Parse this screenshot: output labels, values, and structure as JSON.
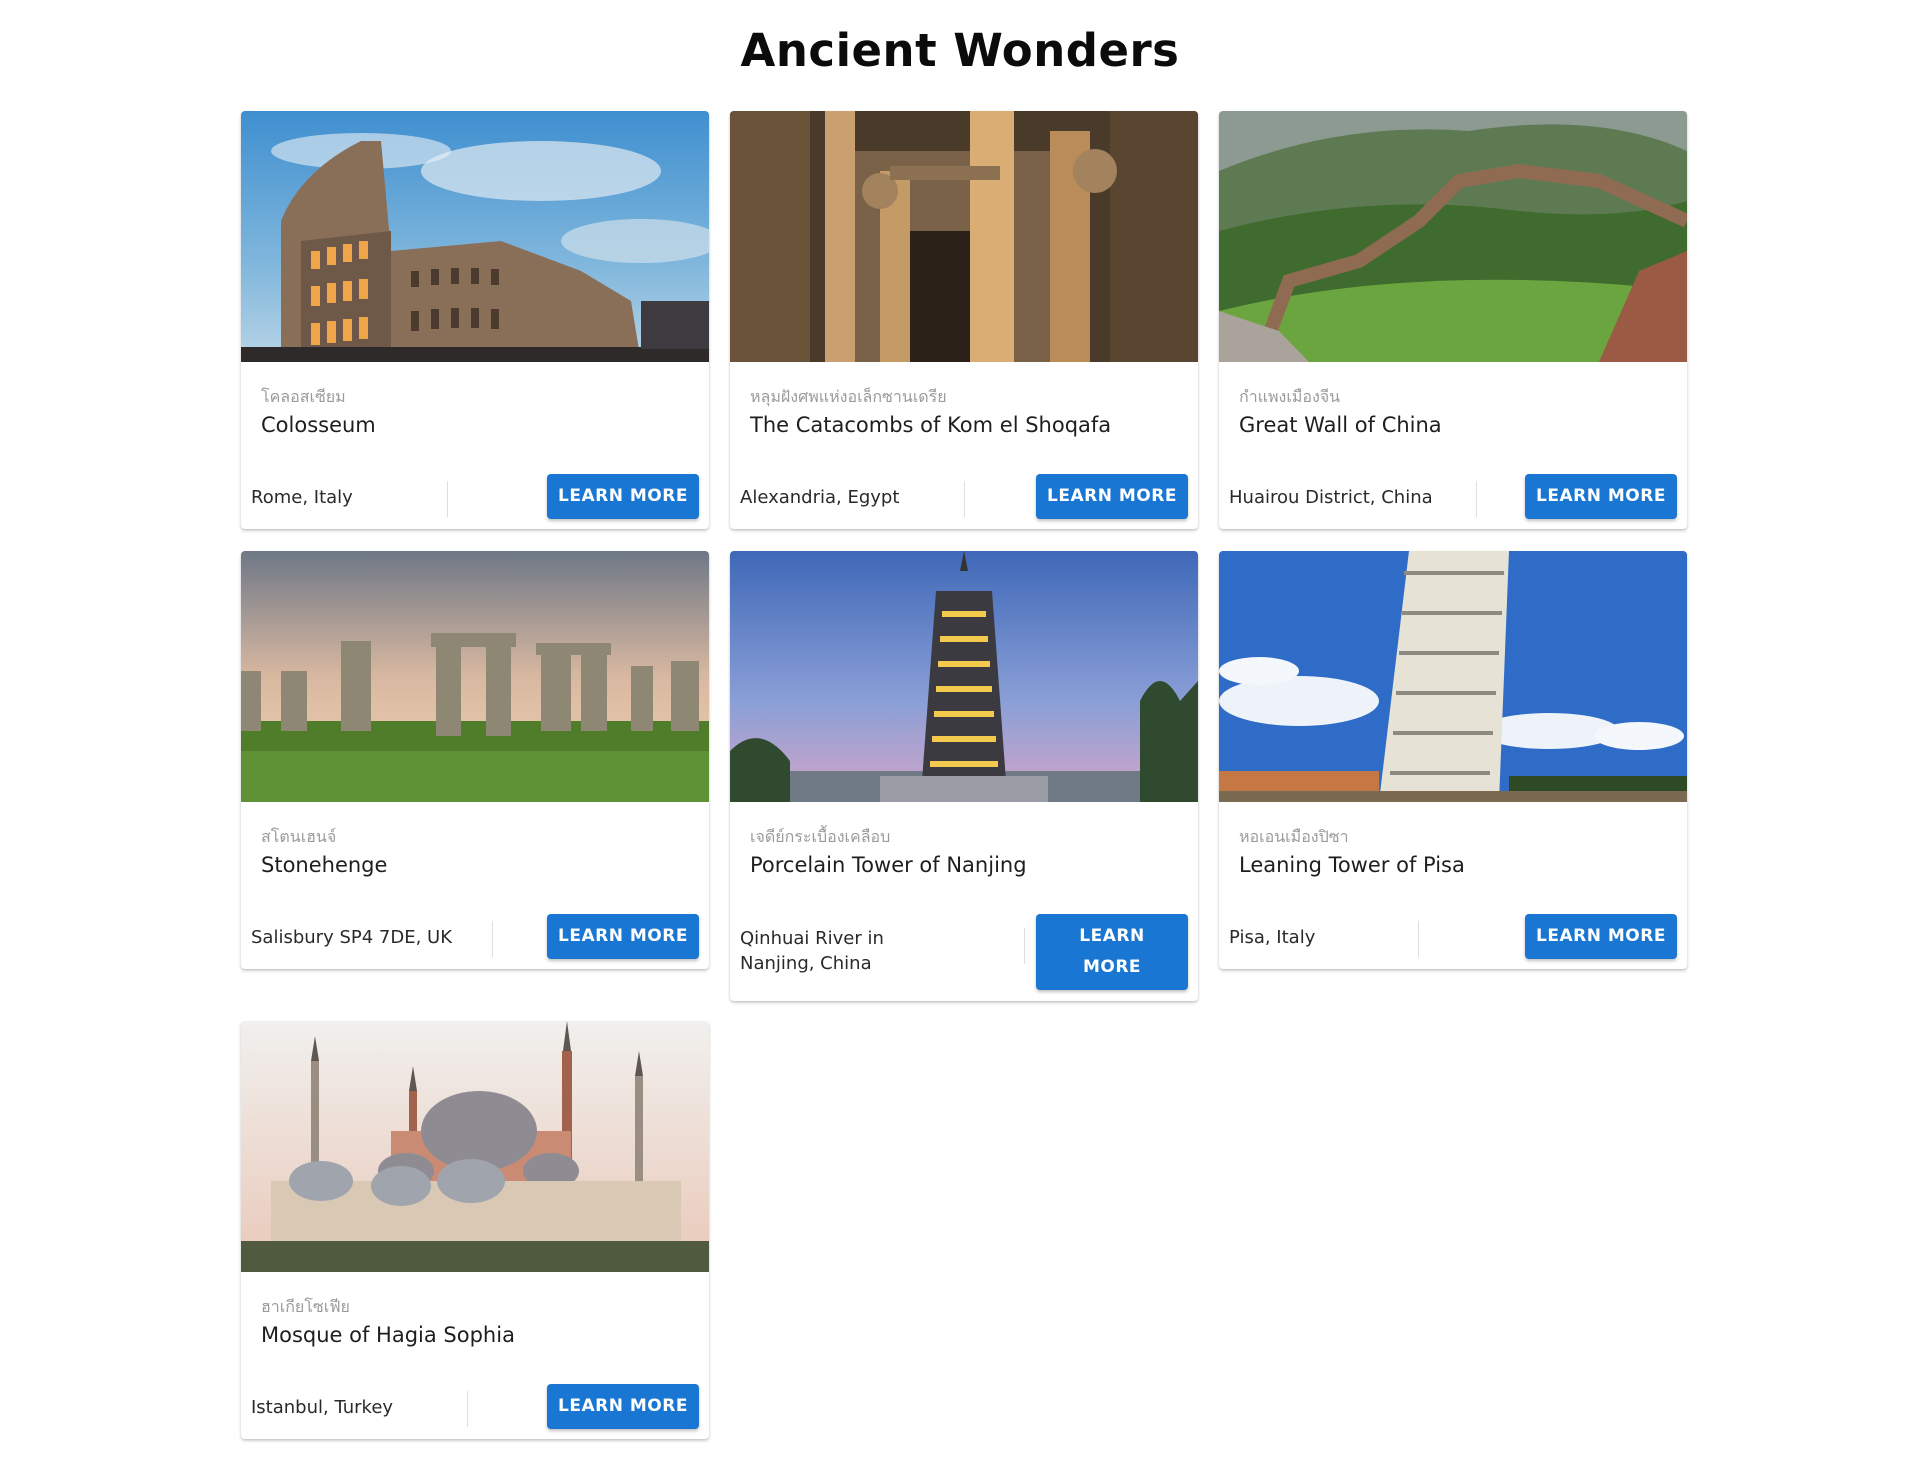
{
  "page": {
    "title": "Ancient Wonders"
  },
  "button_label": "Learn More",
  "colors": {
    "accent": "#1976d2",
    "subtitle": "#9b9b9b",
    "title": "#1e1e1e"
  },
  "cards": [
    {
      "subtitle": "โคลอสเซียม",
      "title": "Colosseum",
      "location": "Rome, Italy",
      "image": "colosseum-photo"
    },
    {
      "subtitle": "หลุมฝังศพแห่งอเล็กซานเดรีย",
      "title": "The Catacombs of Kom el Shoqafa",
      "location": "Alexandria, Egypt",
      "image": "catacombs-photo"
    },
    {
      "subtitle": "กำแพงเมืองจีน",
      "title": "Great Wall of China",
      "location": "Huairou District, China",
      "image": "great-wall-photo"
    },
    {
      "subtitle": "สโตนเฮนจ์",
      "title": "Stonehenge",
      "location": "Salisbury SP4 7DE, UK",
      "image": "stonehenge-photo"
    },
    {
      "subtitle": "เจดีย์กระเบื้องเคลือบ",
      "title": "Porcelain Tower of Nanjing",
      "location": "Qinhuai River in Nanjing, China",
      "image": "porcelain-tower-photo"
    },
    {
      "subtitle": "หอเอนเมืองปิซา",
      "title": "Leaning Tower of Pisa",
      "location": "Pisa, Italy",
      "image": "pisa-tower-photo"
    },
    {
      "subtitle": "ฮาเกียโซเฟีย",
      "title": "Mosque of Hagia Sophia",
      "location": "Istanbul, Turkey",
      "image": "hagia-sophia-photo"
    }
  ]
}
